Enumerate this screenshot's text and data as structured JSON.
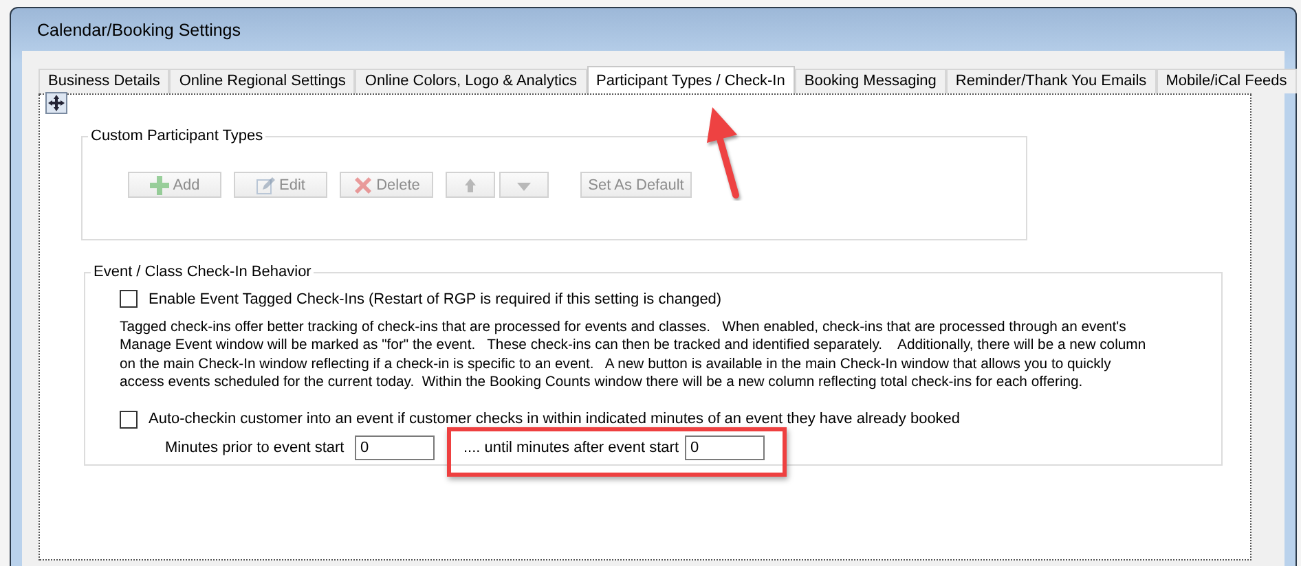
{
  "window": {
    "title": "Calendar/Booking Settings"
  },
  "tabs": [
    {
      "label": "Business Details",
      "selected": false
    },
    {
      "label": "Online Regional Settings",
      "selected": false
    },
    {
      "label": "Online Colors, Logo & Analytics",
      "selected": false
    },
    {
      "label": "Participant Types / Check-In",
      "selected": true
    },
    {
      "label": "Booking Messaging",
      "selected": false
    },
    {
      "label": "Reminder/Thank You Emails",
      "selected": false
    },
    {
      "label": "Mobile/iCal Feeds",
      "selected": false
    }
  ],
  "custom_participant_types": {
    "title": "Custom Participant Types",
    "buttons": [
      {
        "kind": "add",
        "label": "Add",
        "disabled": true
      },
      {
        "kind": "edit",
        "label": "Edit",
        "disabled": true
      },
      {
        "kind": "delete",
        "label": "Delete",
        "disabled": true
      },
      {
        "kind": "up",
        "disabled": true
      },
      {
        "kind": "down",
        "disabled": true
      },
      {
        "kind": "text",
        "label": "Set As Default",
        "disabled": true
      }
    ]
  },
  "check_in_behavior": {
    "title": "Event / Class Check-In Behavior",
    "enable_tagged": {
      "label": "Enable Event Tagged Check-Ins (Restart of RGP is required if this setting is changed)",
      "checked": false
    },
    "description": "Tagged check-ins offer better tracking of check-ins that are processed for events and classes.   When enabled, check-ins that are processed through an event's\nManage Event window will be marked as \"for\" the event.   These check-ins can then be tracked and identified separately.    Additionally, there will be a new column\non the main Check-In window reflecting if a check-in is specific to an event.   A new button is available in the main Check-In window that allows you to quickly\naccess events scheduled for the current today.  Within the Booking Counts window there will be a new column reflecting total check-ins for each offering.",
    "auto_checkin": {
      "label": "Auto-checkin customer into an event if customer checks in within indicated minutes of an event they have already booked",
      "checked": false
    },
    "minutes_prior": {
      "label": "Minutes prior to event start",
      "value": "0"
    },
    "minutes_after": {
      "label": ".... until minutes after event start",
      "value": "0"
    }
  }
}
